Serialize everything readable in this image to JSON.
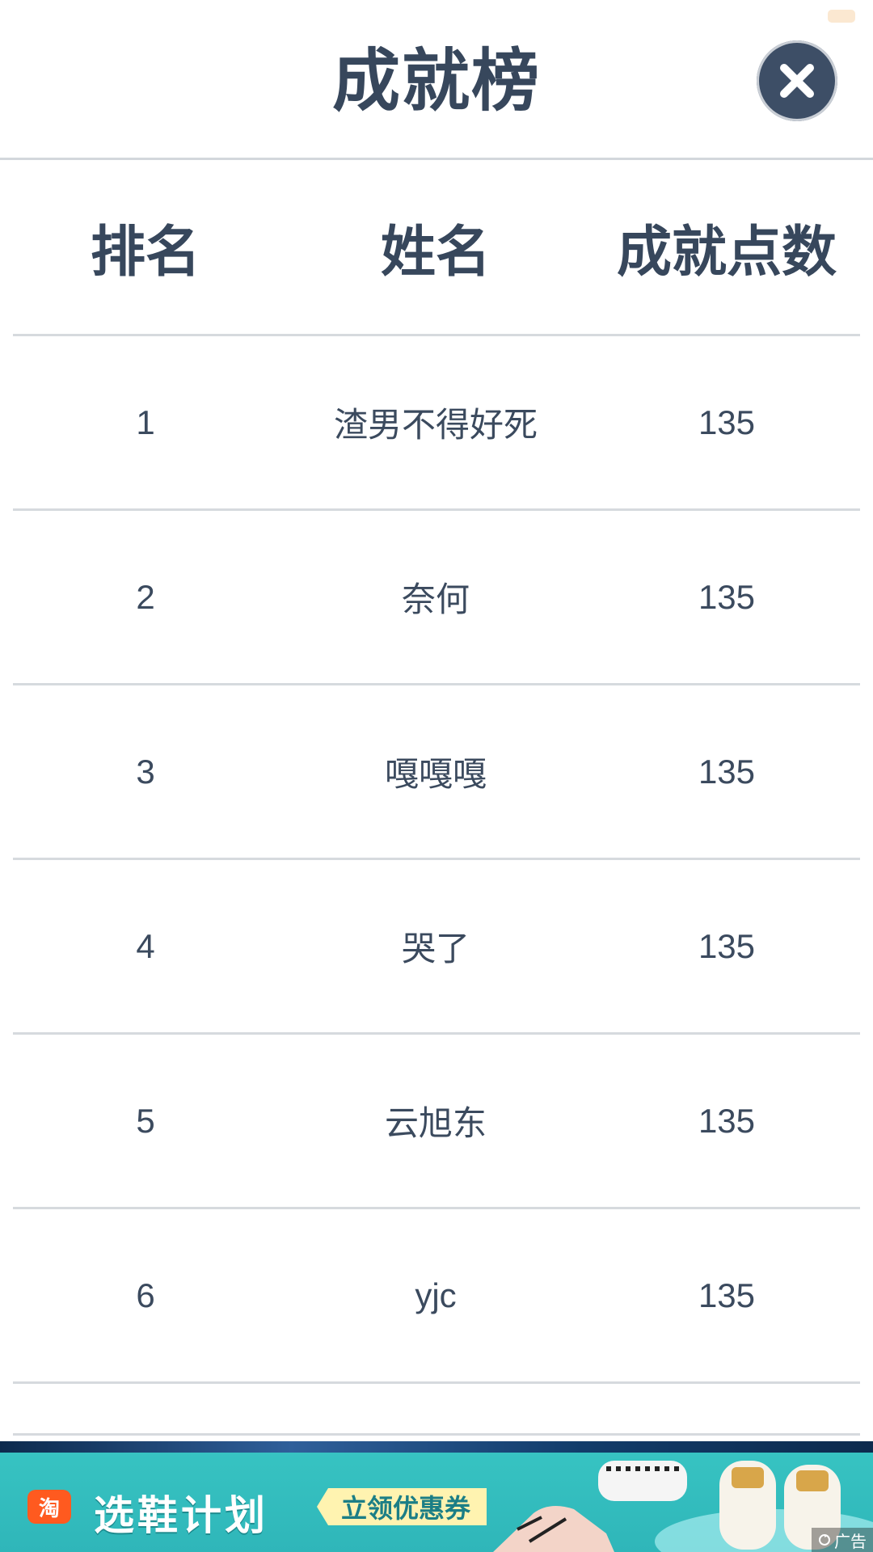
{
  "header": {
    "title": "成就榜",
    "close_icon": "close-icon"
  },
  "table": {
    "columns": [
      "排名",
      "姓名",
      "成就点数"
    ],
    "rows": [
      {
        "rank": "1",
        "name": "渣男不得好死",
        "points": "135"
      },
      {
        "rank": "2",
        "name": "奈何",
        "points": "135"
      },
      {
        "rank": "3",
        "name": "嘎嘎嘎",
        "points": "135"
      },
      {
        "rank": "4",
        "name": "哭了",
        "points": "135"
      },
      {
        "rank": "5",
        "name": "云旭东",
        "points": "135"
      },
      {
        "rank": "6",
        "name": "yjc",
        "points": "135"
      }
    ]
  },
  "ad": {
    "badge": "淘",
    "title": "选鞋计划",
    "coupon": "立领优惠券",
    "tag": "广告"
  },
  "colors": {
    "text": "#3b4a5e",
    "close_button": "#3d4e66",
    "divider": "#d6dade",
    "ad_background": "#37c3c2"
  }
}
